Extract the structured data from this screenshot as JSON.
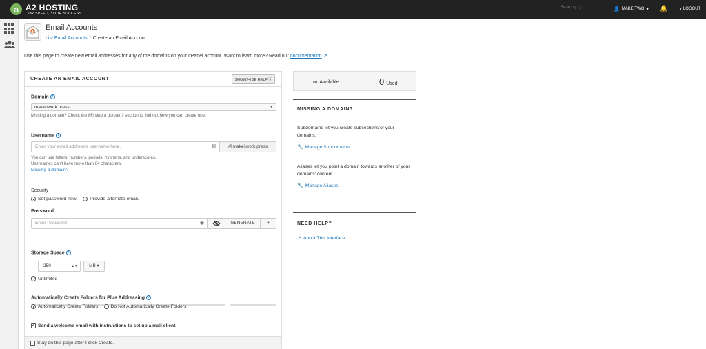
{
  "topbar": {
    "brand": "A2 HOSTING",
    "tagline": "OUR SPEED, YOUR SUCCESS",
    "search_placeholder": "Search ( / )",
    "username": "MAKEITWO",
    "logout": "LOGOUT"
  },
  "header": {
    "title": "Email Accounts",
    "breadcrumb": [
      "List Email Accounts",
      "Create an Email Account"
    ],
    "intro_text": "Use this page to create new email addresses for any of the domains on your cPanel account. Want to learn more? Read our",
    "intro_link": "documentation",
    "intro_end": "."
  },
  "form": {
    "panel_title": "CREATE AN EMAIL ACCOUNT",
    "help_button": "SHOW/HIDE HELP",
    "domain": {
      "label": "Domain",
      "value": "makeitwork.press",
      "help_prefix": "Missing a domain? Check the",
      "help_italic": "Missing a domain?",
      "help_suffix": "section to find out how you can create one."
    },
    "username": {
      "label": "Username",
      "placeholder": "Enter your email address's username here.",
      "suffix": "@makeitwork.press",
      "help_line1": "You can use letters, numbers, periods, hyphens, and underscores.",
      "help_line2": "Usernames can't have more than 64 characters.",
      "missing_link": "Missing a domain?"
    },
    "security": {
      "label": "Security",
      "option_set": "Set password now.",
      "option_alt": "Provide alternate email."
    },
    "password": {
      "label": "Password",
      "placeholder": "Enter Password",
      "generate": "GENERATE"
    },
    "storage": {
      "label": "Storage Space",
      "value": "250",
      "unit": "MB",
      "unlimited": "Unlimited"
    },
    "folders": {
      "label": "Automatically Create Folders for Plus Addressing",
      "option_auto": "Automatically Create Folders",
      "option_manual": "Do Not Automatically Create Folders"
    },
    "welcome": "Send a welcome email with instructions to set up a mail client.",
    "stay": {
      "prefix": "Stay on this page after I click",
      "italic": "Create",
      "suffix": "."
    }
  },
  "side": {
    "available_label": "Available",
    "used_count": "0",
    "used_label": "Used",
    "missing_title": "MISSING A DOMAIN?",
    "missing_text1": "Subdomains let you create subsections of your domains.",
    "manage_subdomains": "Manage Subdomains",
    "missing_text2": "Aliases let you point a domain towards another of your domains' content.",
    "manage_aliases": "Manage Aliases",
    "help_title": "NEED HELP?",
    "about_link": "About This Interface"
  },
  "colors": {
    "topbar": "#222222",
    "link": "#1a75bb",
    "logo_green": "#7ab55c"
  }
}
